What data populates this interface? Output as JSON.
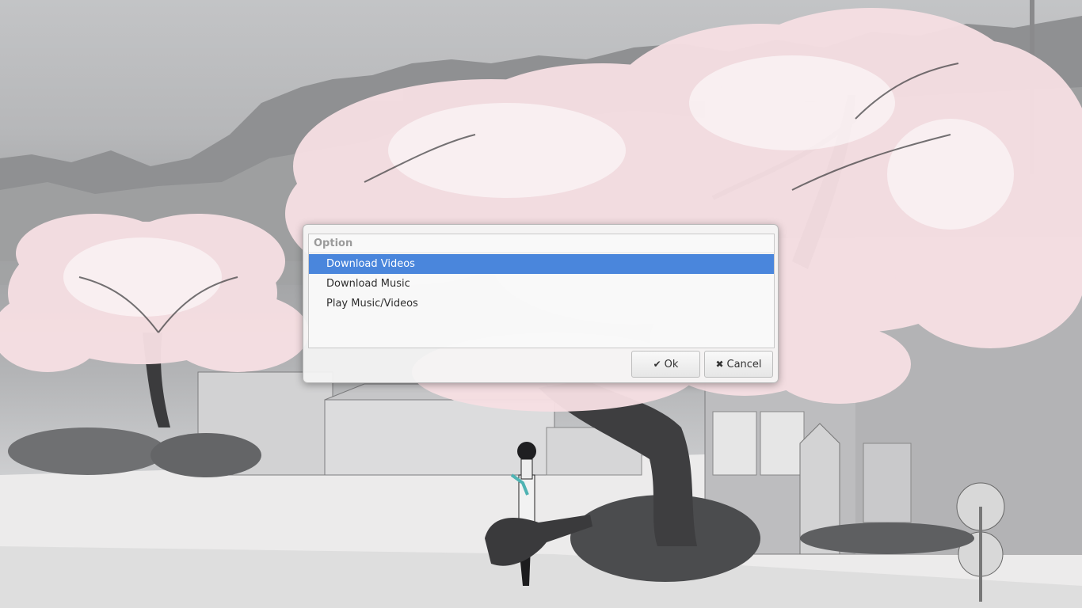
{
  "dialog": {
    "column_header": "Option",
    "options": [
      {
        "label": "Download Videos",
        "selected": true
      },
      {
        "label": "Download Music",
        "selected": false
      },
      {
        "label": "Play Music/Videos",
        "selected": false
      }
    ],
    "ok_label": "Ok",
    "cancel_label": "Cancel",
    "ok_icon": "checkmark-icon",
    "cancel_icon": "x-icon"
  },
  "colors": {
    "selection": "#4a86dc",
    "blossom": "#f6dfe3"
  }
}
